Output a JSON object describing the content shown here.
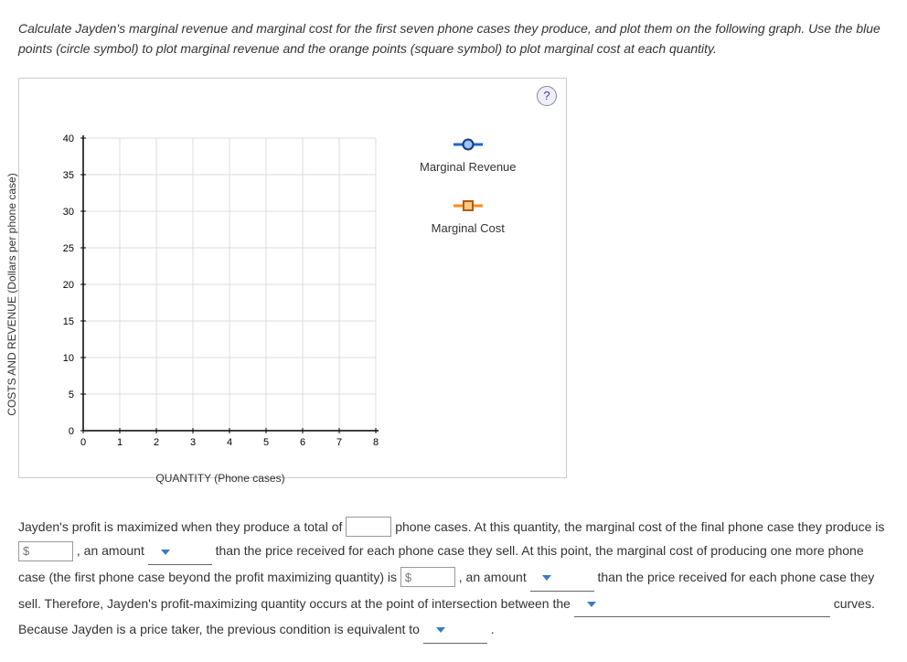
{
  "instructions": "Calculate Jayden's marginal revenue and marginal cost for the first seven phone cases they produce, and plot them on the following graph. Use the blue points (circle symbol) to plot marginal revenue and the orange points (square symbol) to plot marginal cost at each quantity.",
  "help_label": "?",
  "legend": {
    "mr": "Marginal Revenue",
    "mc": "Marginal Cost"
  },
  "chart_data": {
    "type": "scatter",
    "title": "",
    "x_ticks": [
      "0",
      "1",
      "2",
      "3",
      "4",
      "5",
      "6",
      "7",
      "8"
    ],
    "y_ticks": [
      "0",
      "5",
      "10",
      "15",
      "20",
      "25",
      "30",
      "35",
      "40"
    ],
    "xlabel": "QUANTITY (Phone cases)",
    "ylabel": "COSTS AND REVENUE (Dollars per phone case)",
    "xlim": [
      0,
      8
    ],
    "ylim": [
      0,
      40
    ],
    "series": [
      {
        "name": "Marginal Revenue",
        "symbol": "circle",
        "color": "#1e66d0",
        "x": [],
        "y": []
      },
      {
        "name": "Marginal Cost",
        "symbol": "square",
        "color": "#ff8c1a",
        "x": [],
        "y": []
      }
    ]
  },
  "qtext": {
    "p1a": "Jayden's profit is maximized when they produce a total of ",
    "p1b": " phone cases. At this quantity, the marginal cost of the final phone case they produce is ",
    "p1c": ", an amount ",
    "p1d": " than the price received for each phone case they sell. At this point, the marginal cost of producing one more phone case (the first phone case beyond the profit maximizing quantity) is ",
    "p1e": ", an amount ",
    "p1f": " than the price received for each phone case they sell. Therefore, Jayden's profit-maximizing quantity occurs at the point of intersection between the ",
    "p1g": " curves. Because Jayden is a price taker, the previous condition is equivalent to ",
    "p1h": " ."
  },
  "placeholders": {
    "money": "$"
  }
}
